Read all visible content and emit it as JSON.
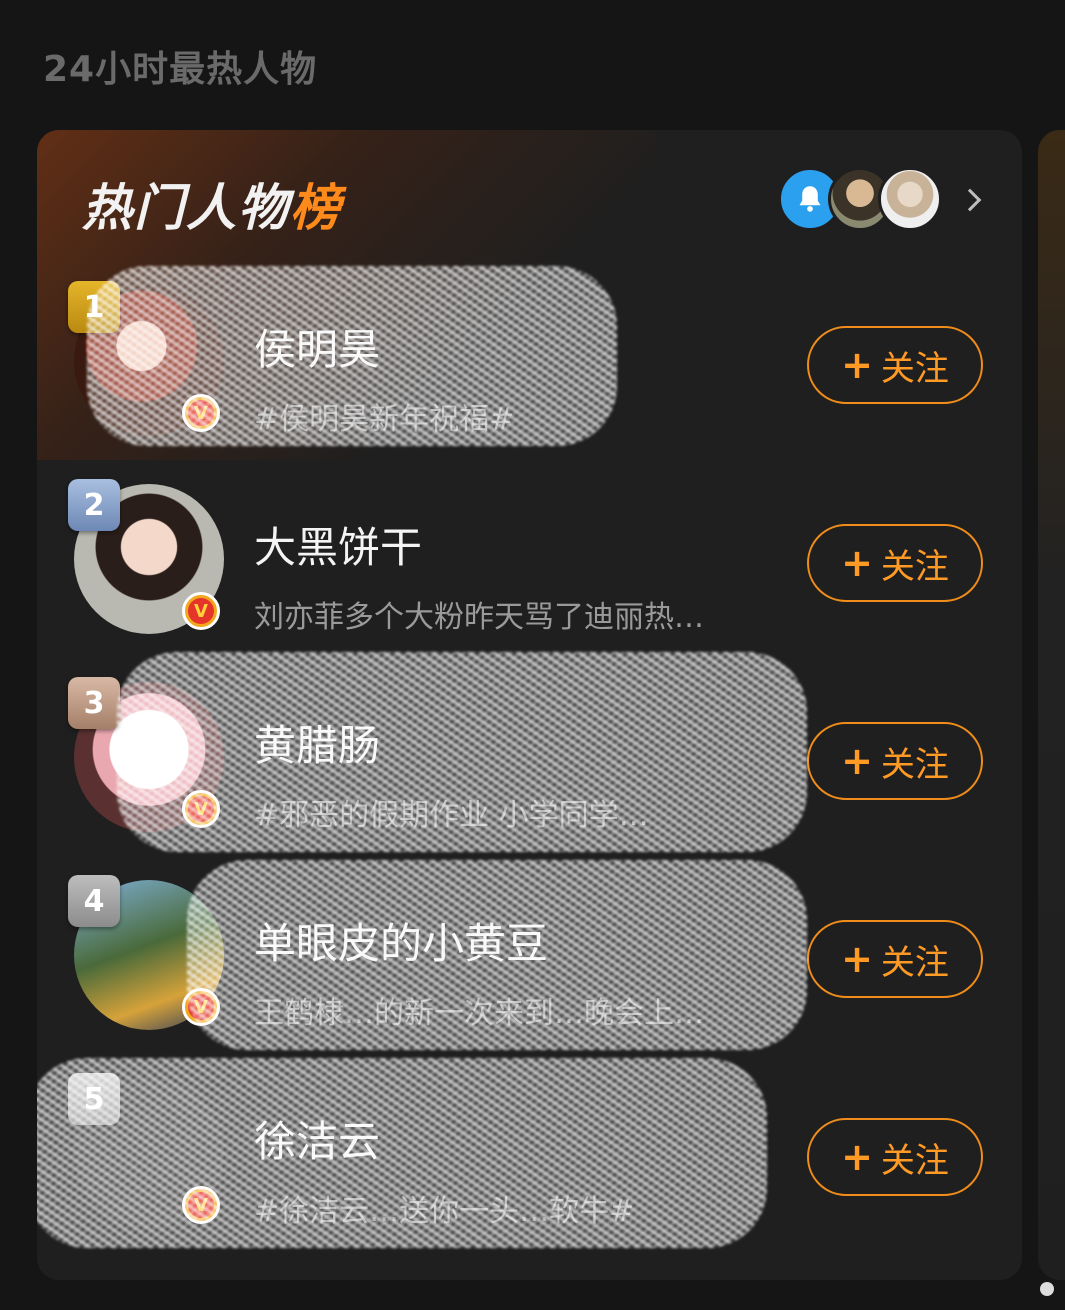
{
  "page": {
    "heading": "24小时最热人物"
  },
  "card": {
    "title_main": "热门人物",
    "title_accent": "榜",
    "header_avatars": [
      "bell-icon",
      "celebrity-avatar",
      "celebrity-avatar"
    ]
  },
  "ranking": [
    {
      "rank": "1",
      "name": "侯明昊",
      "desc": "#侯明昊新年祝福#",
      "follow": "关注"
    },
    {
      "rank": "2",
      "name": "大黑饼干",
      "desc": "刘亦菲多个大粉昨天骂了迪丽热…",
      "follow": "关注"
    },
    {
      "rank": "3",
      "name": "黄腊肠",
      "desc": "#邪恶的假期作业 小学同学…",
      "follow": "关注"
    },
    {
      "rank": "4",
      "name": "单眼皮的小黄豆",
      "desc": "王鹤棣…的新一次来到…晚会上…",
      "follow": "关注"
    },
    {
      "rank": "5",
      "name": "徐洁云",
      "desc": "#徐洁云…送你一头…软牛#",
      "follow": "关注"
    }
  ],
  "colors": {
    "accent": "#ff8a1c",
    "follow": "#f08c1a",
    "card_bg": "#1f1f1f",
    "page_bg": "#151515"
  }
}
